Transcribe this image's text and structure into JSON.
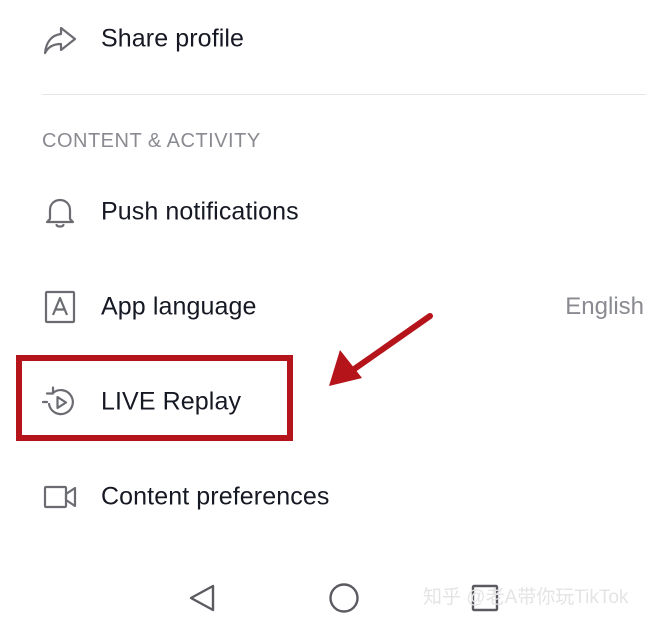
{
  "settings": {
    "share_profile": {
      "label": "Share profile",
      "icon": "share-arrow-icon"
    },
    "section_header": "CONTENT & ACTIVITY",
    "items": [
      {
        "label": "Push notifications",
        "icon": "bell-icon"
      },
      {
        "label": "App language",
        "value": "English",
        "icon": "language-letter-a-icon"
      },
      {
        "label": "LIVE Replay",
        "icon": "live-replay-icon"
      },
      {
        "label": "Content preferences",
        "icon": "video-camera-icon"
      }
    ]
  },
  "annotation": {
    "highlight_color": "#b5141a",
    "highlighted_item": "LIVE Replay"
  },
  "nav_bar": {
    "buttons": [
      "back-triangle-icon",
      "home-circle-icon",
      "recents-square-icon"
    ]
  },
  "watermark": "知乎 @老A带你玩TikTok",
  "colors": {
    "text": "#161823",
    "secondary": "#8a8b91",
    "divider": "#e6e6e8",
    "icon": "#161823"
  }
}
